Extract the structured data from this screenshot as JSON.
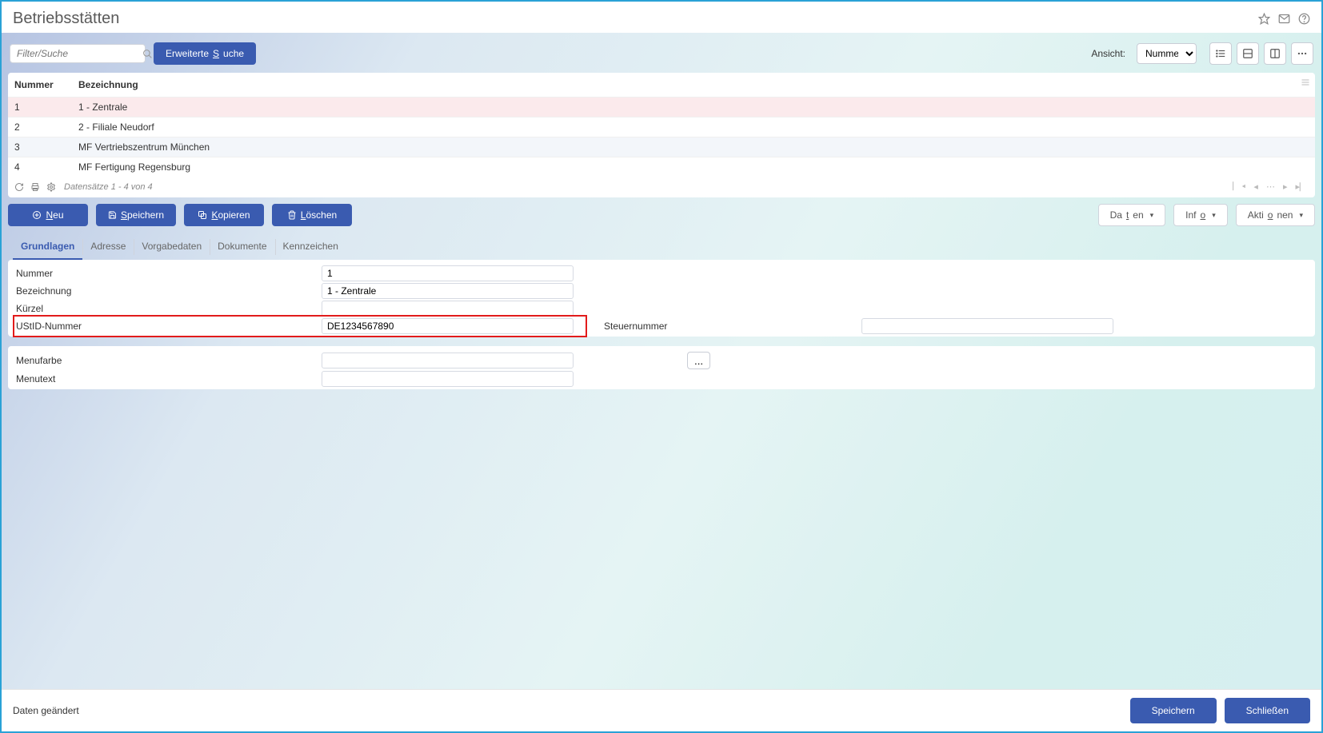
{
  "header": {
    "title": "Betriebsstätten"
  },
  "toolbar1": {
    "search_placeholder": "Filter/Suche",
    "extended_search_pre": "Erweiterte ",
    "extended_search_key": "S",
    "extended_search_post": "uche",
    "view_label": "Ansicht:",
    "view_value": "Nummer"
  },
  "grid": {
    "headers": {
      "nummer": "Nummer",
      "bezeichnung": "Bezeichnung"
    },
    "rows": [
      {
        "num": "1",
        "bez": "1 - Zentrale",
        "selected": true
      },
      {
        "num": "2",
        "bez": "2 - Filiale Neudorf"
      },
      {
        "num": "3",
        "bez": "MF Vertriebszentrum München",
        "alt": true
      },
      {
        "num": "4",
        "bez": "MF Fertigung Regensburg"
      }
    ],
    "footer_text": "Datensätze 1 - 4 von 4"
  },
  "action_bar": {
    "neu_key": "N",
    "neu_post": "eu",
    "speichern_key": "S",
    "speichern_post": "peichern",
    "kopieren_key": "K",
    "kopieren_post": "opieren",
    "loeschen_key": "L",
    "loeschen_post": "öschen",
    "daten_pre": "Da",
    "daten_key": "t",
    "daten_post": "en",
    "info_pre": "Inf",
    "info_key": "o",
    "aktionen_pre": "Akti",
    "aktionen_key": "o",
    "aktionen_post": "nen"
  },
  "tabs": {
    "grundlagen": "Grundlagen",
    "adresse": "Adresse",
    "vorgabedaten": "Vorgabedaten",
    "dokumente": "Dokumente",
    "kennzeichen": "Kennzeichen"
  },
  "form": {
    "nummer_label": "Nummer",
    "nummer_value": "1",
    "bezeichnung_label": "Bezeichnung",
    "bezeichnung_value": "1 - Zentrale",
    "kuerzel_label": "Kürzel",
    "kuerzel_value": "",
    "ustid_label": "UStID-Nummer",
    "ustid_value": "DE1234567890",
    "steuernummer_label": "Steuernummer",
    "steuernummer_value": "",
    "menufarbe_label": "Menufarbe",
    "menufarbe_value": "",
    "menutext_label": "Menutext",
    "menutext_value": "",
    "ellipsis": "..."
  },
  "footer": {
    "status": "Daten geändert",
    "save": "Speichern",
    "close": "Schließen"
  }
}
